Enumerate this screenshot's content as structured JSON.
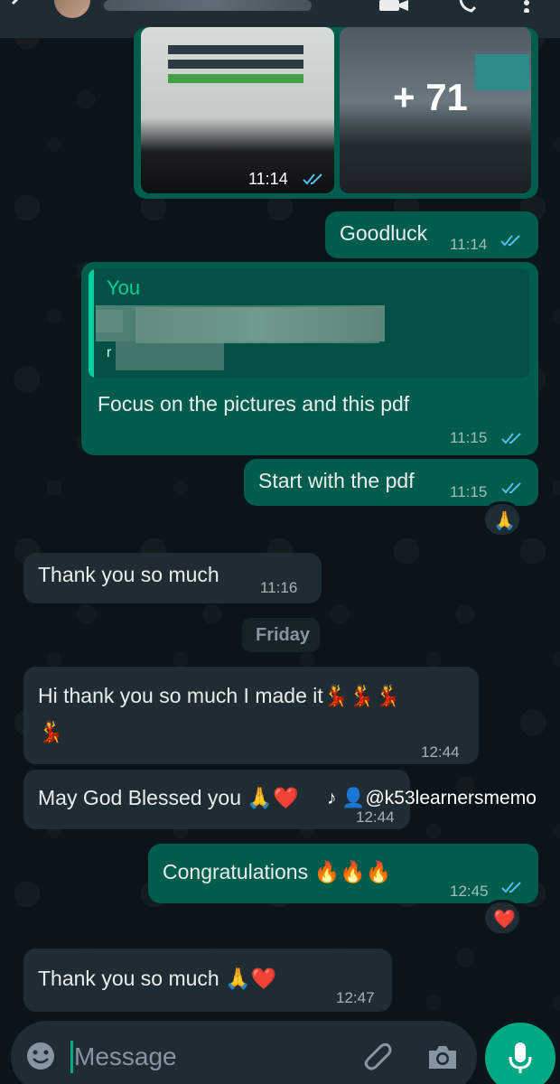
{
  "image_message": {
    "more_count": "+ 71",
    "time": "11:14"
  },
  "messages": [
    {
      "text": "Goodluck",
      "time": "11:14"
    },
    {
      "quote_author": "You",
      "quote_fragment": "r",
      "text": "Focus on the pictures and this pdf",
      "time": "11:15"
    },
    {
      "text": "Start with the pdf",
      "time": "11:15",
      "reaction": "🙏"
    },
    {
      "text": "Thank you so much",
      "time": "11:16"
    },
    {
      "text_line1": "Hi thank you so much I made it💃💃💃",
      "text_line2": "💃",
      "time": "12:44"
    },
    {
      "text": "May God Blessed you 🙏❤️",
      "time": "12:44"
    },
    {
      "text": "Congratulations 🔥🔥🔥",
      "time": "12:45",
      "reaction": "❤️"
    },
    {
      "text": "Thank you so much 🙏❤️",
      "time": "12:47"
    }
  ],
  "date_separator": "Friday",
  "watermark": "♪ 👤@k53learnersmemo",
  "composer": {
    "placeholder": "Message"
  },
  "colors": {
    "background": "#0b141a",
    "outgoing_bubble": "#005c4b",
    "incoming_bubble": "#202c33",
    "accent": "#00a884",
    "read_ticks": "#53bdeb"
  }
}
